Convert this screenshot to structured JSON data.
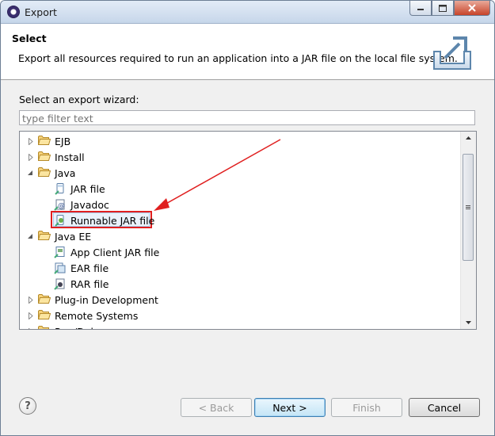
{
  "window": {
    "title": "Export"
  },
  "header": {
    "title": "Select",
    "description": "Export all resources required to run an application into a JAR file on the local file system."
  },
  "wizard": {
    "label": "Select an export wizard:",
    "filter_placeholder": "type filter text",
    "tree": [
      {
        "label": "EJB",
        "type": "folder",
        "expanded": false
      },
      {
        "label": "Install",
        "type": "folder",
        "expanded": false
      },
      {
        "label": "Java",
        "type": "folder",
        "expanded": true
      },
      {
        "label": "JAR file",
        "type": "jar-icon"
      },
      {
        "label": "Javadoc",
        "type": "javadoc-icon"
      },
      {
        "label": "Runnable JAR file",
        "type": "runnable-jar-icon",
        "selected": true
      },
      {
        "label": "Java EE",
        "type": "folder",
        "expanded": true
      },
      {
        "label": "App Client JAR file",
        "type": "app-client-jar-icon"
      },
      {
        "label": "EAR file",
        "type": "ear-icon"
      },
      {
        "label": "RAR file",
        "type": "rar-icon"
      },
      {
        "label": "Plug-in Development",
        "type": "folder",
        "expanded": false
      },
      {
        "label": "Remote Systems",
        "type": "folder",
        "expanded": false
      },
      {
        "label": "Run/Debug",
        "type": "folder",
        "expanded": false
      }
    ]
  },
  "buttons": {
    "help": "?",
    "back": "< Back",
    "next": "Next >",
    "finish": "Finish",
    "cancel": "Cancel"
  },
  "colors": {
    "annotation": "#e02020",
    "selection": "#eaf2fb"
  }
}
